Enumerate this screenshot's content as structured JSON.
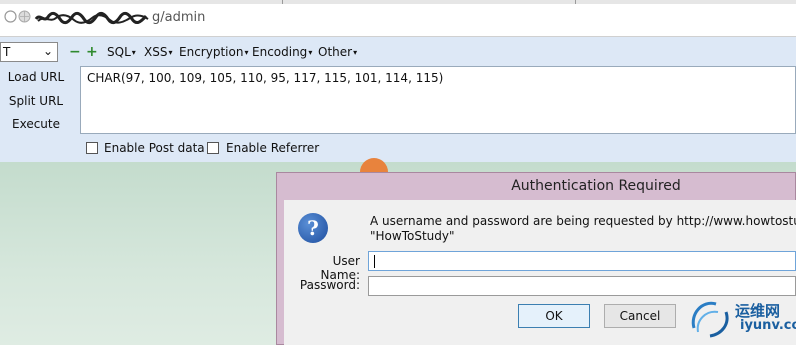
{
  "browser": {
    "url_scribble_text": "www.howtostudy.org",
    "url_visible_suffix": "g/admin"
  },
  "hackbar": {
    "select_value": "T",
    "plus_minus": {
      "minus": "−",
      "plus": "+"
    },
    "menus": [
      "SQL",
      "XSS",
      "Encryption",
      "Encoding",
      "Other"
    ],
    "side_buttons": {
      "load": "Load URL",
      "split": "Split URL",
      "execute": "Execute"
    },
    "textarea_value": "CHAR(97, 100, 109, 105, 110, 95, 117, 115, 101, 114, 115)",
    "checkboxes": [
      {
        "label": "Enable Post data",
        "checked": false
      },
      {
        "label": "Enable Referrer",
        "checked": false
      }
    ]
  },
  "dialog": {
    "title": "Authentication Required",
    "icon": "question-icon",
    "message_line1": "A username and password are being requested by http://www.howtostudy.org. T",
    "message_line2": "\"HowToStudy\"",
    "username_label": "User Name:",
    "username_value": "",
    "password_label": "Password:",
    "password_value": "",
    "ok_label": "OK",
    "cancel_label": "Cancel"
  },
  "watermark": {
    "cn": "运维网",
    "en": "iyunv.com"
  },
  "colors": {
    "hackbar_bg": "#dde8f6",
    "dialog_frame": "#d6bcd0",
    "page_bg": "#c4dccd",
    "accent_blue": "#1a5fa0"
  }
}
